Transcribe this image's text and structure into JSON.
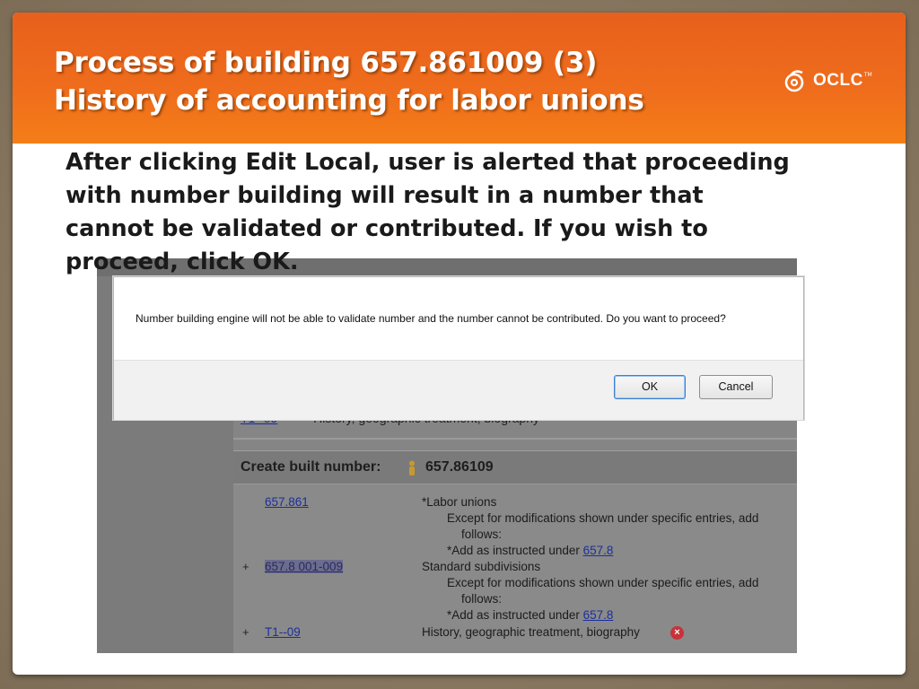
{
  "slide": {
    "title_line1": "Process of building 657.861009 (3)",
    "title_line2": "History of accounting for labor unions",
    "logo_text": "OCLC",
    "logo_tm": "TM",
    "body_lines": [
      "After clicking Edit Local, user is alerted that proceeding",
      "with number building will result in a number that",
      "cannot be validated or contributed.  If you wish to",
      "proceed, click OK."
    ]
  },
  "dialog": {
    "message": "Number building engine will not be able to validate number and the number cannot be contributed. Do you want to proceed?",
    "ok_label": "OK",
    "cancel_label": "Cancel"
  },
  "background_app": {
    "top_row": {
      "code": "T1--09",
      "desc": "History, geographic treatment, biography"
    },
    "panel_title": "Create built number:",
    "built_number": "657.86109",
    "entries": [
      {
        "code": "657.861",
        "lines": [
          "*Labor unions",
          "Except for modifications shown under specific entries, add",
          "follows:",
          "*Add as instructed under "
        ],
        "ref": "657.8"
      },
      {
        "prefix": "+",
        "code": "657.8 001-009",
        "lines": [
          "Standard subdivisions",
          "Except for modifications shown under specific entries, add",
          "follows:",
          "*Add as instructed under "
        ],
        "ref": "657.8"
      },
      {
        "prefix": "+",
        "code": "T1--09",
        "lines": [
          "History, geographic treatment, biography"
        ]
      }
    ]
  },
  "colors": {
    "banner_orange": "#ef6d1c",
    "link_blue": "#1c2f9a",
    "error_red": "#c8323a"
  },
  "icons": [
    "oclc-logo-icon",
    "person-icon",
    "error-icon"
  ]
}
